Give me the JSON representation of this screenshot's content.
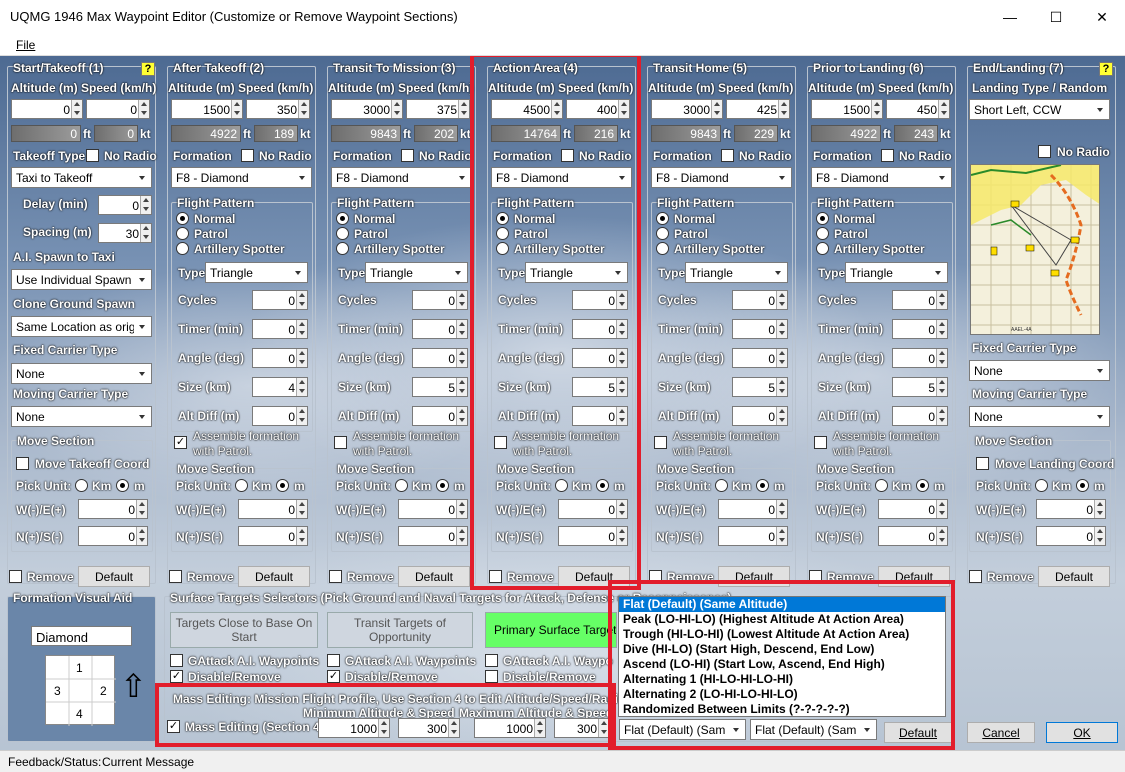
{
  "window": {
    "title": "UQMG 1946 Max Waypoint Editor (Customize or Remove Waypoint Sections)",
    "menu_file": "File"
  },
  "common": {
    "altitude_speed": "Altitude (m) Speed (km/h)",
    "ft": "ft",
    "kt": "kt",
    "no_radio": "No Radio",
    "formation": "Formation",
    "flight_pattern": "Flight Pattern",
    "normal": "Normal",
    "patrol": "Patrol",
    "artillery": "Artillery Spotter",
    "type": "Type",
    "cycles": "Cycles",
    "timer": "Timer (min)",
    "angle": "Angle (deg)",
    "size": "Size (km)",
    "altdiff": "Alt Diff (m)",
    "assemble1": "Assemble formation",
    "assemble2": "with Patrol.",
    "move_section": "Move Section",
    "pick_unit": "Pick Unit:",
    "km": "Km",
    "m": "m",
    "we": "W(-)/E(+)",
    "ns": "N(+)/S(-)",
    "remove": "Remove",
    "default": "Default",
    "help": "?"
  },
  "sections": [
    {
      "title": "Start/Takeoff (1)",
      "alt": "0",
      "speed": "0",
      "ft": "0",
      "kt": "0",
      "takeoff_type_label": "Takeoff Type",
      "takeoff_type": "Taxi to Takeoff",
      "delay_label": "Delay (min)",
      "delay": "0",
      "spacing_label": "Spacing (m)",
      "spacing": "30",
      "ai_spawn_label": "A.I. Spawn to Taxi",
      "ai_spawn": "Use Individual Spawn",
      "clone_label": "Clone Ground Spawn",
      "clone": "Same Location as orig",
      "fixed_carrier_label": "Fixed Carrier Type",
      "fixed_carrier": "None",
      "moving_carrier_label": "Moving Carrier Type",
      "moving_carrier": "None",
      "move_coord": "Move Takeoff Coord",
      "we": "0",
      "ns": "0"
    },
    {
      "title": "After Takeoff (2)",
      "alt": "1500",
      "speed": "350",
      "ft": "4922",
      "kt": "189",
      "formation": "F8 - Diamond",
      "pattern": "Triangle",
      "cycles": "0",
      "timer": "0",
      "angle": "0",
      "size": "4",
      "altdiff": "0",
      "we": "0",
      "ns": "0",
      "assemble": "true"
    },
    {
      "title": "Transit To Mission (3)",
      "alt": "3000",
      "speed": "375",
      "ft": "9843",
      "kt": "202",
      "formation": "F8 - Diamond",
      "pattern": "Triangle",
      "cycles": "0",
      "timer": "0",
      "angle": "0",
      "size": "5",
      "altdiff": "0",
      "we": "0",
      "ns": "0",
      "assemble": "false"
    },
    {
      "title": "Action Area (4)",
      "alt": "4500",
      "speed": "400",
      "ft": "14764",
      "kt": "216",
      "formation": "F8 - Diamond",
      "pattern": "Triangle",
      "cycles": "0",
      "timer": "0",
      "angle": "0",
      "size": "5",
      "altdiff": "0",
      "we": "0",
      "ns": "0",
      "assemble": "false"
    },
    {
      "title": "Transit Home (5)",
      "alt": "3000",
      "speed": "425",
      "ft": "9843",
      "kt": "229",
      "formation": "F8 - Diamond",
      "pattern": "Triangle",
      "cycles": "0",
      "timer": "0",
      "angle": "0",
      "size": "5",
      "altdiff": "0",
      "we": "0",
      "ns": "0",
      "assemble": "false"
    },
    {
      "title": "Prior to Landing (6)",
      "alt": "1500",
      "speed": "450",
      "ft": "4922",
      "kt": "243",
      "formation": "F8 - Diamond",
      "pattern": "Triangle",
      "cycles": "0",
      "timer": "0",
      "angle": "0",
      "size": "5",
      "altdiff": "0",
      "we": "0",
      "ns": "0",
      "assemble": "false"
    },
    {
      "title": "End/Landing (7)",
      "landing_label": "Landing Type / Random",
      "landing": "Short Left, CCW",
      "fixed_carrier_label": "Fixed Carrier Type",
      "fixed_carrier": "None",
      "moving_carrier_label": "Moving Carrier Type",
      "moving_carrier": "None",
      "move_coord": "Move Landing Coord",
      "we": "0",
      "ns": "0"
    }
  ],
  "formation_aid": {
    "title": "Formation Visual Aid",
    "value": "Diamond",
    "cells": [
      "1",
      "3",
      "2",
      "4"
    ],
    "arrow": "⇧"
  },
  "surface": {
    "title": "Surface Targets Selectors (Pick Ground and Naval Targets for Attack, Defense or Reconnaissance)",
    "btn1": "Targets Close to Base On Start",
    "btn2": "Transit Targets of Opportunity",
    "btn3": "Primary Surface Target",
    "gattack": "GAttack A.I. Waypoints",
    "gattack_trunc": "GAttack A.I. Waypo",
    "disable": "Disable/Remove"
  },
  "mass": {
    "title": "Mass Editing:  Mission Flight Profile, Use Section 4 to Edit Altitude/Speed/Radius",
    "min_label": "Minimum Altitude & Speed",
    "max_label": "Maximum Altitude & Speed",
    "checkbox": "Mass Editing (Section 4)",
    "min_alt": "1000",
    "min_speed": "300",
    "max_alt": "1000",
    "max_speed": "300"
  },
  "profile": {
    "options": [
      "Flat (Default) (Same Altitude)",
      "Peak (LO-HI-LO) (Highest Altitude At Action Area)",
      "Trough (HI-LO-HI) (Lowest Altitude At Action Area)",
      "Dive (HI-LO) (Start High, Descend, End Low)",
      "Ascend (LO-HI) (Start Low, Ascend, End High)",
      "Alternating 1 (HI-LO-HI-LO-HI)",
      "Alternating 2 (LO-HI-LO-HI-LO)",
      "Randomized Between Limits (?-?-?-?-?)"
    ],
    "combo1": "Flat (Default) (Sam",
    "combo2": "Flat (Default) (Sam",
    "default": "Default"
  },
  "footer": {
    "cancel": "Cancel",
    "ok": "OK",
    "status_label": "Feedback/Status:",
    "status": "Current Message"
  },
  "map": {
    "label": "AAEL-4A"
  },
  "colors": {
    "highlight": "#e21d2b",
    "selection": "#0078d7",
    "help": "#ffff33",
    "primary": "#66ff66"
  }
}
